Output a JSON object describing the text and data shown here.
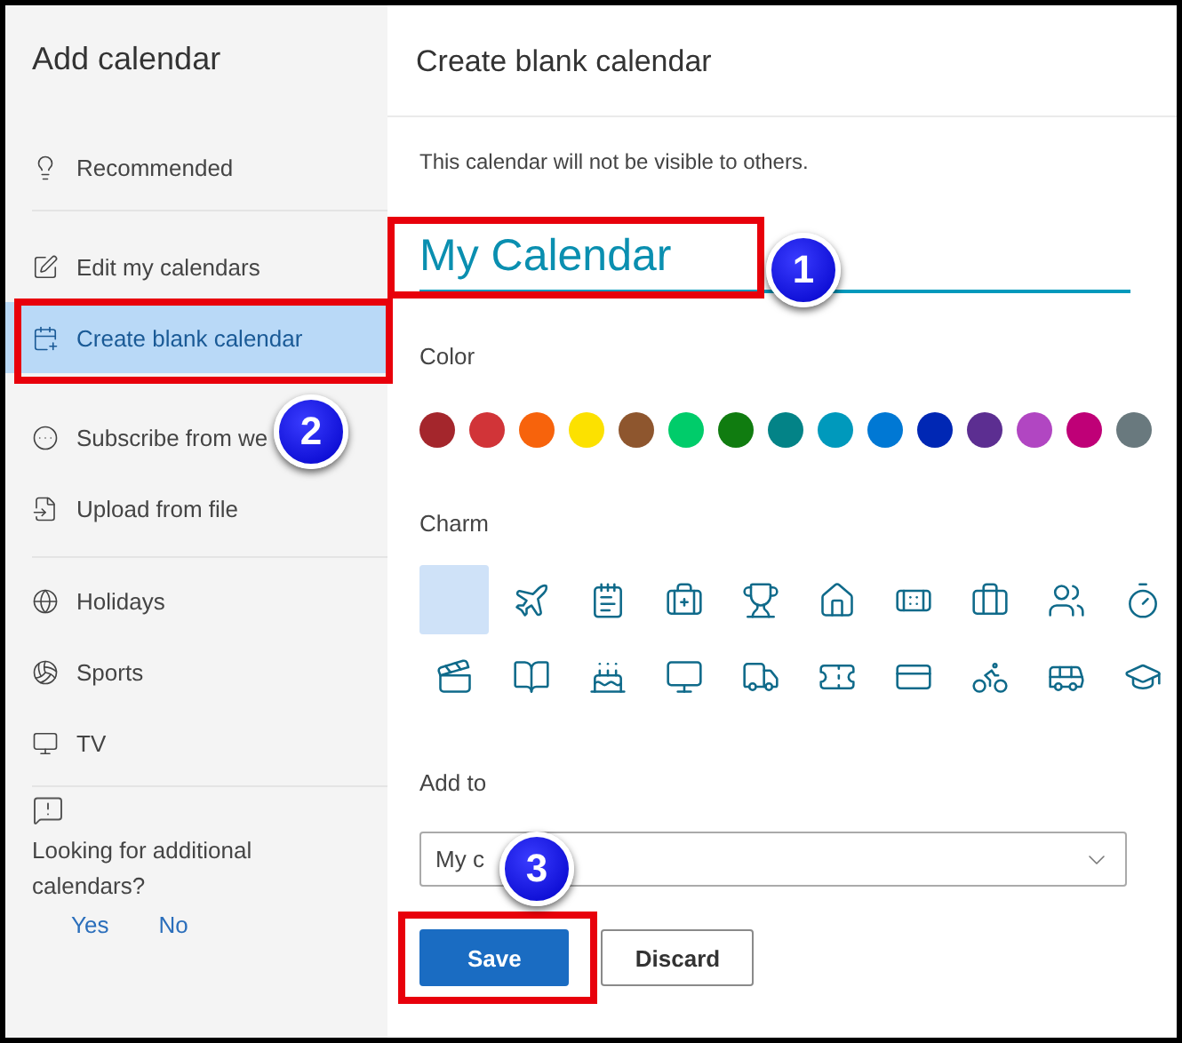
{
  "sidebar": {
    "title": "Add calendar",
    "sections": [
      {
        "items": [
          {
            "kind": "bulb",
            "label": "Recommended",
            "selected": false
          }
        ]
      },
      {
        "items": [
          {
            "kind": "edit",
            "label": "Edit my calendars",
            "selected": false
          },
          {
            "kind": "calendar-plus",
            "label": "Create blank calendar",
            "selected": true
          },
          {
            "kind": "subscribe",
            "label": "Subscribe from we",
            "selected": false
          },
          {
            "kind": "file",
            "label": "Upload from file",
            "selected": false
          }
        ]
      },
      {
        "items": [
          {
            "kind": "globe",
            "label": "Holidays",
            "selected": false
          },
          {
            "kind": "ball",
            "label": "Sports",
            "selected": false
          },
          {
            "kind": "tv",
            "label": "TV",
            "selected": false
          }
        ]
      }
    ],
    "feedback": {
      "question": "Looking for additional calendars?",
      "links": [
        "Yes",
        "No"
      ]
    }
  },
  "panel": {
    "title": "Create blank calendar",
    "note": "This calendar will not be visible to others.",
    "name": {
      "value": "My Calendar"
    },
    "color_label": "Color",
    "colors": [
      {
        "color": "#a4262c"
      },
      {
        "color": "#d13438"
      },
      {
        "color": "#f7630c"
      },
      {
        "color": "#fce100"
      },
      {
        "color": "#8e562e"
      },
      {
        "color": "#00cc6a"
      },
      {
        "color": "#107c10"
      },
      {
        "color": "#038387"
      },
      {
        "color": "#0099bc"
      },
      {
        "color": "#0078d4"
      },
      {
        "color": "#0027b4"
      },
      {
        "color": "#5c2e91"
      },
      {
        "color": "#b146c2"
      },
      {
        "color": "#bf0077"
      },
      {
        "color": "#69797e"
      }
    ],
    "charm_label": "Charm",
    "charms": [
      {
        "kind": "none",
        "selected": true
      },
      {
        "kind": "plane",
        "selected": false
      },
      {
        "kind": "notepad",
        "selected": false
      },
      {
        "kind": "medkit",
        "selected": false
      },
      {
        "kind": "trophy",
        "selected": false
      },
      {
        "kind": "home",
        "selected": false
      },
      {
        "kind": "bandage",
        "selected": false
      },
      {
        "kind": "briefcase",
        "selected": false
      },
      {
        "kind": "people",
        "selected": false
      },
      {
        "kind": "timer",
        "selected": false
      },
      {
        "kind": "clapper",
        "selected": false
      },
      {
        "kind": "book",
        "selected": false
      },
      {
        "kind": "cake",
        "selected": false
      },
      {
        "kind": "monitor",
        "selected": false
      },
      {
        "kind": "truck",
        "selected": false
      },
      {
        "kind": "ticket",
        "selected": false
      },
      {
        "kind": "card",
        "selected": false
      },
      {
        "kind": "bike",
        "selected": false
      },
      {
        "kind": "bus",
        "selected": false
      },
      {
        "kind": "cap",
        "selected": false
      }
    ],
    "add_to_label": "Add to",
    "add_to": {
      "value": "My c"
    },
    "buttons": [
      {
        "kind": "primary",
        "label": "Save"
      },
      {
        "kind": "secondary",
        "label": "Discard"
      }
    ]
  },
  "annotations": [
    {
      "kind": "frame"
    },
    {
      "kind": "frame"
    },
    {
      "kind": "frame"
    },
    {
      "kind": "callout",
      "label": "1"
    },
    {
      "kind": "callout",
      "label": "2"
    },
    {
      "kind": "callout",
      "label": "3"
    }
  ]
}
